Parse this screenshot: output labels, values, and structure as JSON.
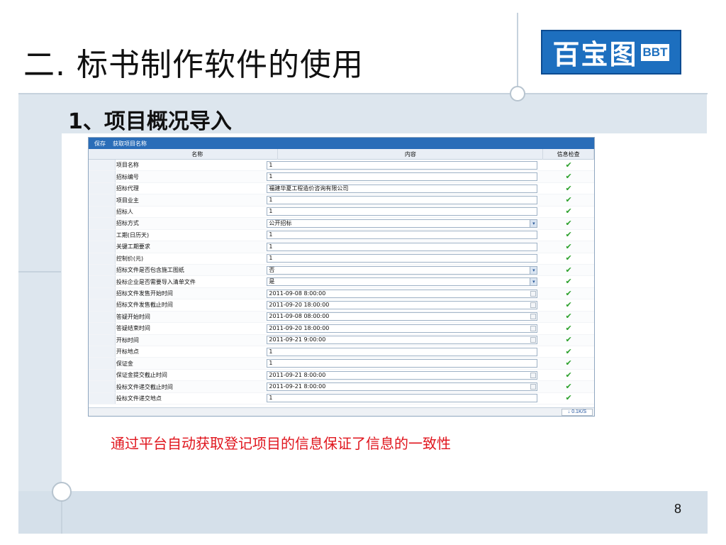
{
  "slide": {
    "title": "二. 标书制作软件的使用",
    "subtitle": "1、项目概况导入",
    "caption": "通过平台自动获取登记项目的信息保证了信息的一致性",
    "page_number": "8",
    "logo": {
      "chinese": "百宝图",
      "latin": "BBT"
    }
  },
  "app": {
    "toolbar": {
      "save": "保存",
      "fetch": "获取项目名称"
    },
    "columns": {
      "name": "名称",
      "content": "内容",
      "check": "信息检查"
    },
    "rows": [
      {
        "name": "项目名称",
        "value": "1",
        "type": "text"
      },
      {
        "name": "招标编号",
        "value": "1",
        "type": "text"
      },
      {
        "name": "招标代理",
        "value": "福建华夏工程造价咨询有限公司",
        "type": "text"
      },
      {
        "name": "项目业主",
        "value": "1",
        "type": "text"
      },
      {
        "name": "招标人",
        "value": "1",
        "type": "text"
      },
      {
        "name": "招标方式",
        "value": "公开招标",
        "type": "select"
      },
      {
        "name": "工期(日历天)",
        "value": "1",
        "type": "text"
      },
      {
        "name": "关键工期要求",
        "value": "1",
        "type": "text"
      },
      {
        "name": "控制价(元)",
        "value": "1",
        "type": "text"
      },
      {
        "name": "招标文件是否包含施工图纸",
        "value": "否",
        "type": "select"
      },
      {
        "name": "投标企业是否需要导入清单文件",
        "value": "是",
        "type": "select"
      },
      {
        "name": "招标文件发售开始时间",
        "value": "2011-09-08 8:00:00",
        "type": "date"
      },
      {
        "name": "招标文件发售截止时间",
        "value": "2011-09-20 18:00:00",
        "type": "date"
      },
      {
        "name": "答疑开始时间",
        "value": "2011-09-08 08:00:00",
        "type": "date"
      },
      {
        "name": "答疑结束时间",
        "value": "2011-09-20 18:00:00",
        "type": "date"
      },
      {
        "name": "开标时间",
        "value": "2011-09-21 9:00:00",
        "type": "date"
      },
      {
        "name": "开标地点",
        "value": "1",
        "type": "text"
      },
      {
        "name": "保证金",
        "value": "1",
        "type": "text"
      },
      {
        "name": "保证金提交截止时间",
        "value": "2011-09-21 8:00:00",
        "type": "date"
      },
      {
        "name": "投标文件递交截止时间",
        "value": "2011-09-21 8:00:00",
        "type": "date"
      },
      {
        "name": "投标文件递交地点",
        "value": "1",
        "type": "text"
      }
    ],
    "check_glyph": "✔",
    "status_rate": "↓ 0.1K/S"
  },
  "icons": {
    "dropdown": "chevron-down-icon",
    "date": "calendar-icon",
    "check": "check-icon"
  },
  "colors": {
    "toolbar": "#2a6db8",
    "check": "#2ba02b",
    "caption": "#e0161e",
    "logo": "#1d6fbf"
  }
}
